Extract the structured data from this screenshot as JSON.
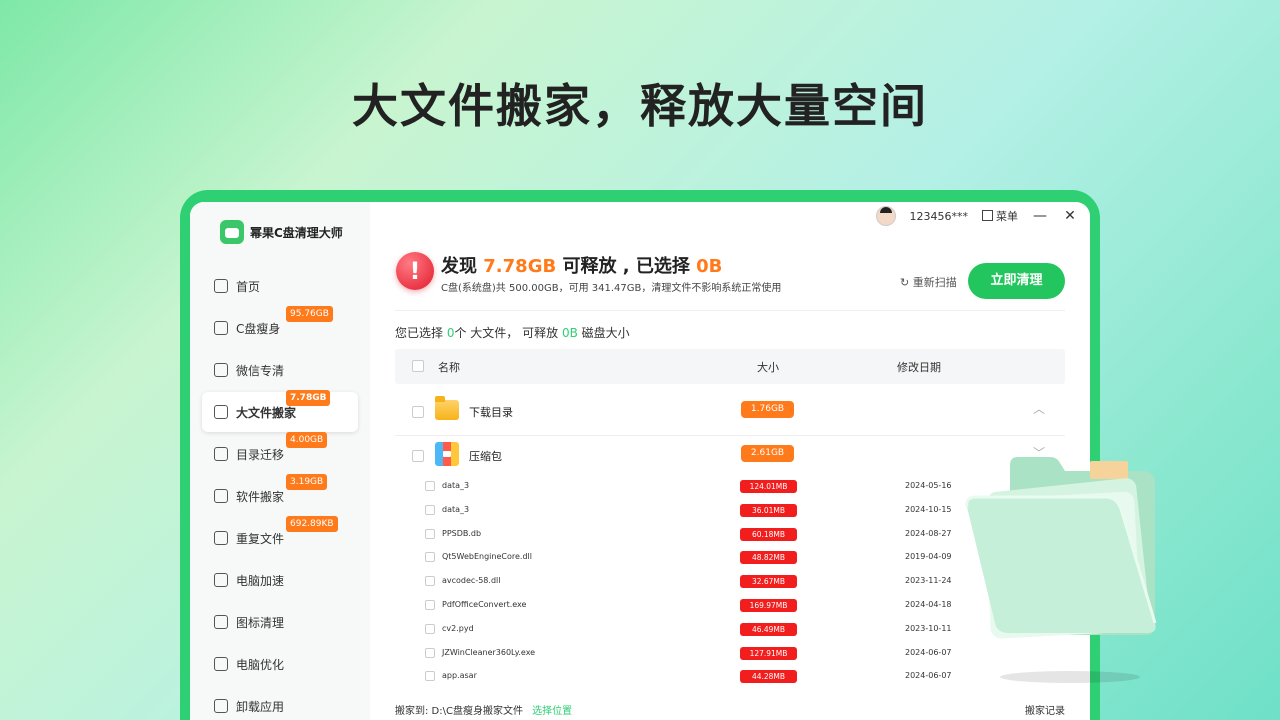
{
  "headline": "大文件搬家，释放大量空间",
  "app": {
    "name": "幂果C盘清理大师"
  },
  "topbar": {
    "user": "123456***",
    "menu_label": "菜单",
    "minimize": "—",
    "close": "✕"
  },
  "sidebar": {
    "items": [
      {
        "label": "首页",
        "badge": "",
        "icon": "home-icon",
        "active": false
      },
      {
        "label": "C盘瘦身",
        "badge": "95.76GB",
        "icon": "disk-icon",
        "active": false
      },
      {
        "label": "微信专清",
        "badge": "",
        "icon": "wechat-icon",
        "active": false
      },
      {
        "label": "大文件搬家",
        "badge": "7.78GB",
        "icon": "move-file-icon",
        "active": true
      },
      {
        "label": "目录迁移",
        "badge": "4.00GB",
        "icon": "folder-move-icon",
        "active": false
      },
      {
        "label": "软件搬家",
        "badge": "3.19GB",
        "icon": "apps-icon",
        "active": false
      },
      {
        "label": "重复文件",
        "badge": "692.89KB",
        "icon": "duplicate-icon",
        "active": false
      },
      {
        "label": "电脑加速",
        "badge": "",
        "icon": "rocket-icon",
        "active": false
      },
      {
        "label": "图标清理",
        "badge": "",
        "icon": "basket-icon",
        "active": false
      },
      {
        "label": "电脑优化",
        "badge": "",
        "icon": "monitor-icon",
        "active": false
      },
      {
        "label": "卸载应用",
        "badge": "",
        "icon": "trash-icon",
        "active": false
      }
    ]
  },
  "scan": {
    "alert_mark": "!",
    "found_prefix": "发现",
    "found_size": "7.78GB",
    "found_mid": "可释放 , 已选择",
    "selected_size": "0B",
    "disk_info": "C盘(系统盘)共 500.00GB，可用 341.47GB，清理文件不影响系统正常使用",
    "rescan_label": "重新扫描",
    "clean_label": "立即清理"
  },
  "summary": {
    "prefix": "您已选择",
    "count": "0",
    "mid": "个 大文件， 可释放",
    "size": "0B",
    "suffix": "磁盘大小"
  },
  "table": {
    "headers": {
      "name": "名称",
      "size": "大小",
      "date": "修改日期"
    },
    "groups": [
      {
        "name": "下载目录",
        "size": "1.76GB",
        "chevron": "︿"
      },
      {
        "name": "压缩包",
        "size": "2.61GB",
        "chevron": "﹀"
      }
    ],
    "files": [
      {
        "name": "data_3",
        "size": "124.01MB",
        "date": "2024-05-16"
      },
      {
        "name": "data_3",
        "size": "36.01MB",
        "date": "2024-10-15"
      },
      {
        "name": "PPSDB.db",
        "size": "60.18MB",
        "date": "2024-08-27"
      },
      {
        "name": "Qt5WebEngineCore.dll",
        "size": "48.82MB",
        "date": "2019-04-09"
      },
      {
        "name": "avcodec-58.dll",
        "size": "32.67MB",
        "date": "2023-11-24"
      },
      {
        "name": "PdfOfficeConvert.exe",
        "size": "169.97MB",
        "date": "2024-04-18"
      },
      {
        "name": "cv2.pyd",
        "size": "46.49MB",
        "date": "2023-10-11"
      },
      {
        "name": "JZWinCleaner360Ly.exe",
        "size": "127.91MB",
        "date": "2024-06-07"
      },
      {
        "name": "app.asar",
        "size": "44.28MB",
        "date": "2024-06-07"
      }
    ]
  },
  "footer": {
    "path": "搬家到: D:\\C盘瘦身搬家文件",
    "choose_label": "选择位置",
    "records_label": "搬家记录"
  },
  "colors": {
    "accent": "#22c55e",
    "badge": "#ff7a1a",
    "danger": "#f21d1d"
  }
}
